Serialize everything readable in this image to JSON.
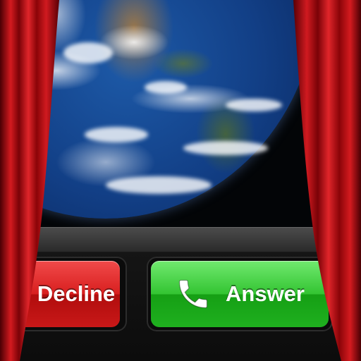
{
  "call_screen": {
    "decline_label": "Decline",
    "answer_label": "Answer"
  },
  "icons": {
    "answer": "phone-handset-icon"
  },
  "colors": {
    "decline": "#d81f1f",
    "answer": "#33c432",
    "curtain": "#b30c12"
  }
}
